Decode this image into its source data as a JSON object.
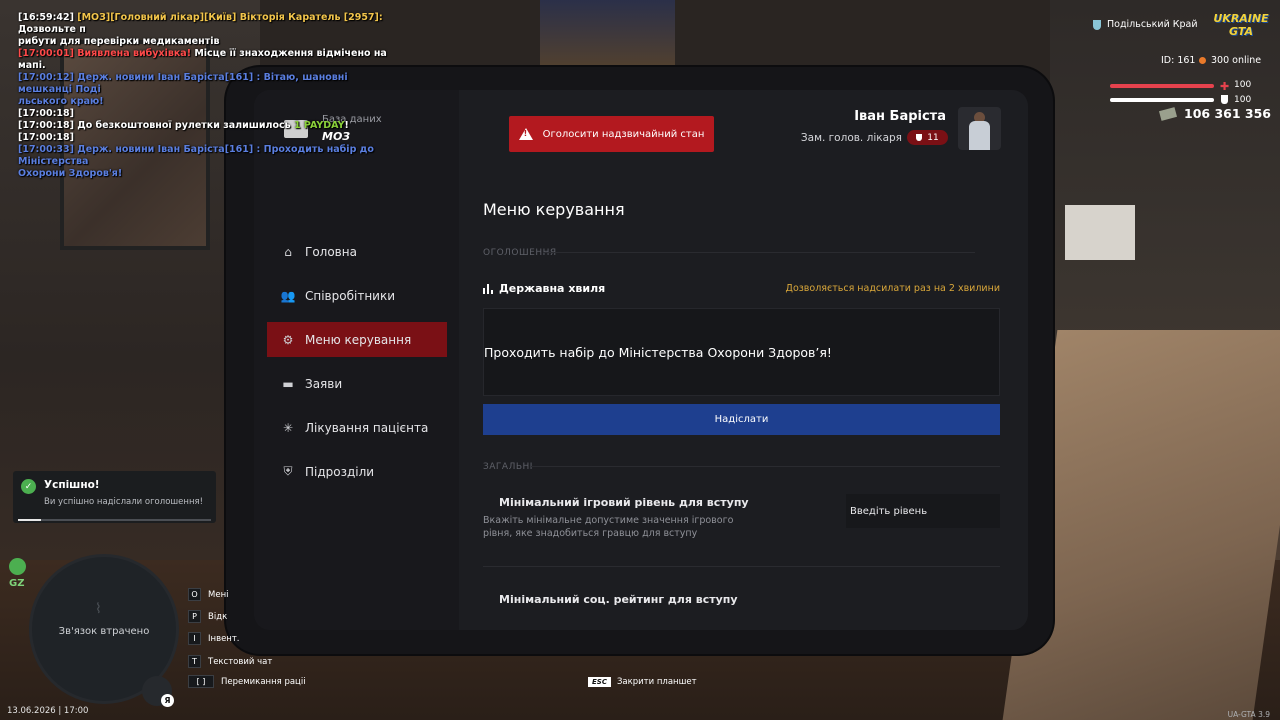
{
  "chat": [
    {
      "parts": [
        {
          "text": "[16:59:42] ",
          "c": "white"
        },
        {
          "text": "[МОЗ][Головний лікар][Київ] Вікторія Каратель [2957]:",
          "c": "yellow"
        },
        {
          "text": " Дозвольте п",
          "c": "white"
        }
      ]
    },
    {
      "parts": [
        {
          "text": "рибути для перевірки медикаментів",
          "c": "white"
        }
      ]
    },
    {
      "parts": [
        {
          "text": "[17:00:01] Виявлена вибухівка!",
          "c": "red"
        },
        {
          "text": " Місце її знаходження відмічено на мапі.",
          "c": "white"
        }
      ]
    },
    {
      "parts": [
        {
          "text": "[17:00:12] Держ. новини Іван Баріста[161] : Вітаю, шановні мешканці Поді",
          "c": "blue"
        }
      ]
    },
    {
      "parts": [
        {
          "text": "льського краю!",
          "c": "blue"
        }
      ]
    },
    {
      "parts": [
        {
          "text": "[17:00:18]",
          "c": "white"
        }
      ]
    },
    {
      "parts": [
        {
          "text": "[17:00:18] До безкоштовної рулетки залишилось ",
          "c": "white"
        },
        {
          "text": "1 PAYDAY",
          "c": "green"
        },
        {
          "text": "!",
          "c": "white"
        }
      ]
    },
    {
      "parts": [
        {
          "text": "[17:00:18]",
          "c": "white"
        }
      ]
    },
    {
      "parts": [
        {
          "text": "[17:00:33] Держ. новини Іван Баріста[161] : Проходить набір до Міністерства",
          "c": "blue"
        }
      ]
    },
    {
      "parts": [
        {
          "text": " Охорони Здоров'я!",
          "c": "blue"
        }
      ]
    }
  ],
  "hud": {
    "region": "Подільський Край",
    "logo": "UKRAINE GTA",
    "id_text": "ID: 161",
    "online_text": "300 online",
    "health": "100",
    "armor": "100",
    "health_fraction": 1.0,
    "armor_fraction": 1.0,
    "money": "106 361 356"
  },
  "tablet": {
    "db_label": "База даних",
    "db_name": "МОЗ",
    "emergency_label": "Оголосити надзвичайний стан",
    "user": {
      "name": "Іван Баріста",
      "role": "Зам. голов. лікаря",
      "rank": "11"
    },
    "nav": [
      {
        "label": "Головна",
        "icon": "home-icon",
        "glyph": "⌂"
      },
      {
        "label": "Співробітники",
        "icon": "users-icon",
        "glyph": "👥"
      },
      {
        "label": "Меню керування",
        "icon": "gear-icon",
        "glyph": "⚙",
        "active": true
      },
      {
        "label": "Заяви",
        "icon": "folder-icon",
        "glyph": "▬"
      },
      {
        "label": "Лікування пацієнта",
        "icon": "spark-icon",
        "glyph": "✳"
      },
      {
        "label": "Підрозділи",
        "icon": "shield-icon",
        "glyph": "⛨"
      }
    ],
    "section_title": "Меню керування",
    "announcements_label": "ОГОЛОШЕННЯ",
    "wave_label": "Державна хвиля",
    "wave_hint": "Дозволяється надсилати раз на 2 хвилини",
    "message": "Проходить набір до Міністерства Охорони Здоров’я!",
    "send_label": "Надіслати",
    "general_label": "ЗАГАЛЬНІ",
    "setting_min_level_title": "Мінімальний ігровий рівень для вступу",
    "setting_min_level_desc": "Вкажіть мінімальне допустиме значення ігрового рівня, яке знадобиться гравцю для вступу",
    "setting_min_level_placeholder": "Введіть рівень",
    "setting_min_rating_title": "Мінімальний соц. рейтинг для вступу"
  },
  "toast": {
    "title": "Успішно!",
    "text": "Ви успішно надіслали оголошення!",
    "progress_fraction": 0.12
  },
  "minimap": {
    "gz_label": "GZ",
    "lost_text": "Зв'язок втрачено",
    "mic_badge": "Я"
  },
  "hotkeys": [
    {
      "key": "O",
      "label": "Мені"
    },
    {
      "key": "P",
      "label": "Відк"
    },
    {
      "key": "I",
      "label": "Інвент."
    },
    {
      "key": "T",
      "label": "Текстовий чат"
    },
    {
      "key": "[ ]",
      "label": "Перемикання раціі"
    }
  ],
  "footer": {
    "datetime": "13.06.2026 | 17:00",
    "esc_key": "ESC",
    "esc_label": "Закрити планшет",
    "version": "UA-GTA 3.9"
  }
}
